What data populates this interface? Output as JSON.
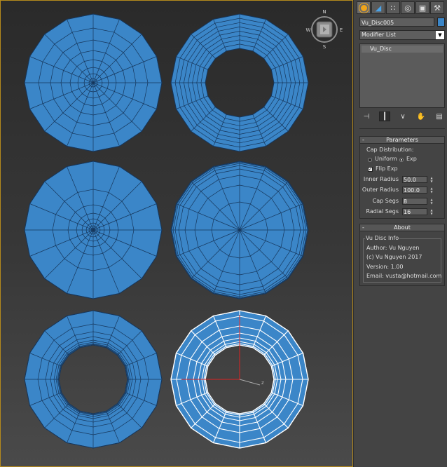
{
  "viewcube": {
    "n": "N",
    "s": "S",
    "e": "E",
    "w": "W"
  },
  "gizmo": {
    "z": "z"
  },
  "colors": {
    "disc_fill": "#3b86c8",
    "wire": "#16365b",
    "selected_wire": "#ffffff",
    "accent": "#f0a51a"
  },
  "panel": {
    "tabs": [
      "create-icon",
      "modify-icon",
      "hierarchy-icon",
      "motion-icon",
      "display-icon",
      "utilities-icon"
    ],
    "object_name": "Vu_Disc005",
    "modifier_list": "Modifier List",
    "stack_items": [
      "Vu_Disc"
    ],
    "stack_tools": [
      "pin-stack-icon",
      "show-end-result-icon",
      "make-unique-icon",
      "remove-modifier-icon",
      "configure-modifier-sets-icon"
    ]
  },
  "parameters": {
    "title": "Parameters",
    "minus": "-",
    "cap_distribution_label": "Cap Distribution:",
    "uniform_label": "Uniform",
    "exp_label": "Exp",
    "selected_distribution": "Exp",
    "flip_exp_label": "Flip Exp",
    "flip_exp_checked": true,
    "inner_radius_label": "Inner Radius",
    "inner_radius_value": "50.0",
    "outer_radius_label": "Outer Radius",
    "outer_radius_value": "100.0",
    "cap_segs_label": "Cap Segs",
    "cap_segs_value": "8",
    "radial_segs_label": "Radial Segs",
    "radial_segs_value": "16"
  },
  "about": {
    "title": "About",
    "minus": "-",
    "group_title": "Vu Disc Info",
    "author": "Author: Vu Nguyen",
    "copyright": "(c) Vu Nguyen 2017",
    "version": "Version: 1.00",
    "email": "Email: vusta@hotmail.com"
  }
}
